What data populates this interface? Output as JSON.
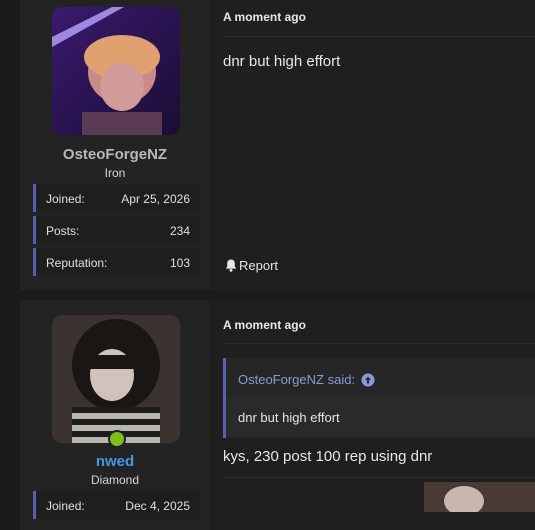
{
  "posts": [
    {
      "user": {
        "name": "OsteoForgeNZ",
        "name_color": "#b8b8b8",
        "rank": "Iron",
        "stats": [
          {
            "label": "Joined:",
            "value": "Apr 25, 2026"
          },
          {
            "label": "Posts:",
            "value": "234"
          },
          {
            "label": "Reputation:",
            "value": "103"
          }
        ]
      },
      "time": "A moment ago",
      "message": "dnr but high effort",
      "report_label": "Report"
    },
    {
      "user": {
        "name": "nwed",
        "name_color": "#3d9be9",
        "rank": "Diamond",
        "online": true,
        "stats": [
          {
            "label": "Joined:",
            "value": "Dec 4, 2025"
          }
        ]
      },
      "time": "A moment ago",
      "quote": {
        "author": "OsteoForgeNZ said:",
        "text": "dnr but high effort"
      },
      "message": "kys, 230 post 100 rep using dnr"
    }
  ],
  "colors": {
    "accent": "#5a5fb0",
    "online": "#7cc11a"
  }
}
